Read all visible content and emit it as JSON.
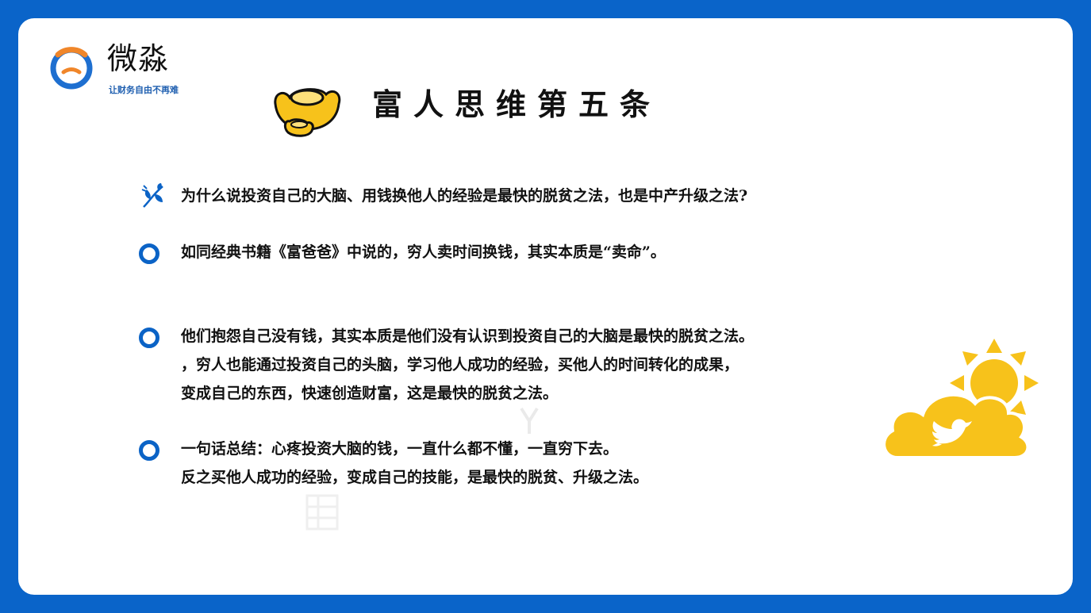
{
  "logo": {
    "name": "微淼",
    "slogan": "让财务自由不再难",
    "icon": "weimiao-logo-icon"
  },
  "title": "富人思维第五条",
  "title_icon": "gold-ingot-icon",
  "items": [
    {
      "bullet": "leaf-sprig-icon",
      "lines": [
        "为什么说投资自己的大脑、用钱换他人的经验是最快的脱贫之法，也是中产升级之法?"
      ]
    },
    {
      "bullet": "circle-ring-icon",
      "lines": [
        "如同经典书籍《富爸爸》中说的，穷人卖时间换钱，其实本质是“卖命”。"
      ]
    },
    {
      "bullet": "circle-ring-icon",
      "lines": [
        "他们抱怨自己没有钱，其实本质是他们没有认识到投资自己的大脑是最快的脱贫之法。",
        "，穷人也能通过投资自己的头脑，学习他人成功的经验，买他人的时间转化的成果，",
        "变成自己的东西，快速创造财富，这是最快的脱贫之法。"
      ]
    },
    {
      "bullet": "circle-ring-icon",
      "lines": [
        "一句话总结：心疼投资大脑的钱，一直什么都不懂，一直穷下去。",
        "反之买他人成功的经验，变成自己的技能，是最快的脱贫、升级之法。"
      ]
    }
  ],
  "decoration": "sun-cloud-twitter-icon",
  "colors": {
    "frame": "#0a64c9",
    "accent": "#0b63c6",
    "gold": "#f7c21b",
    "logo_orange": "#f0862a"
  }
}
